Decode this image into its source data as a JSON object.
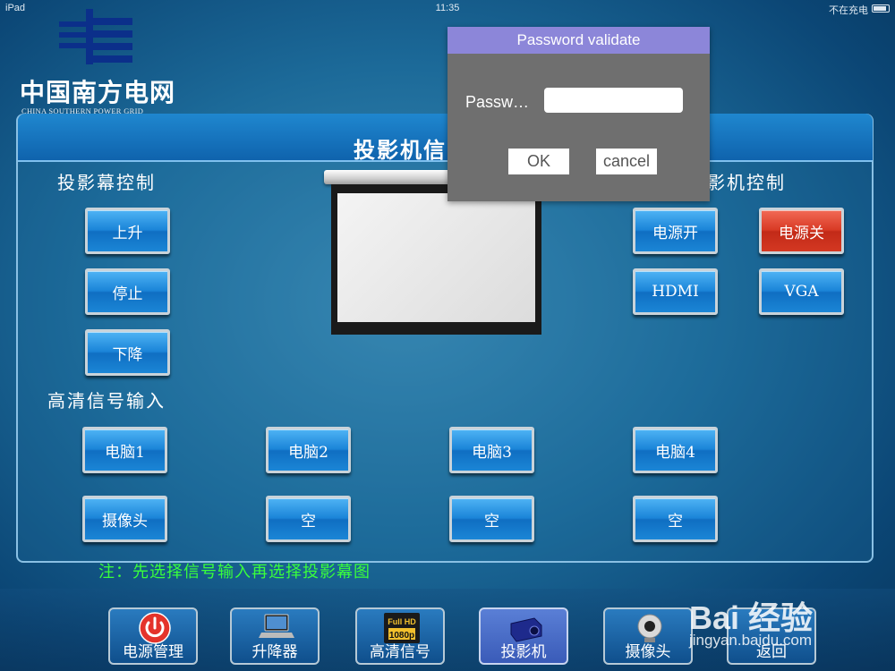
{
  "status_bar": {
    "device": "iPad",
    "time": "11:35",
    "charging": "不在充电"
  },
  "logo": {
    "name_cn": "中国南方电网",
    "name_en": "CHINA SOUTHERN POWER GRID"
  },
  "panel": {
    "title": "投影机信",
    "screen_section": "投影幕控制",
    "projector_section": "影机控制",
    "hd_section": "高清信号输入",
    "note": "注：先选择信号输入再选择投影幕图"
  },
  "screen_buttons": {
    "up": "上升",
    "stop": "停止",
    "down": "下降"
  },
  "projector_buttons": {
    "power_on": "电源开",
    "power_off": "电源关",
    "hdmi": "HDMI",
    "vga": "VGA"
  },
  "input_buttons": [
    "电脑1",
    "电脑2",
    "电脑3",
    "电脑4",
    "摄像头",
    "空",
    "空",
    "空"
  ],
  "bottom_tabs": [
    "电源管理",
    "升降器",
    "高清信号",
    "投影机",
    "摄像头",
    "返回"
  ],
  "hd_badge": {
    "full": "Full HD",
    "res": "1080p"
  },
  "dialog": {
    "title": "Password validate",
    "label": "Passw…",
    "input_value": "",
    "ok": "OK",
    "cancel": "cancel"
  },
  "watermark": {
    "brand": "Bai 经验",
    "url": "jingyan.baidu.com"
  },
  "colors": {
    "accent_blue": "#1a84d8",
    "danger_red": "#d83a25",
    "note_green": "#39ff3c",
    "dialog_title": "#8c86d9"
  }
}
